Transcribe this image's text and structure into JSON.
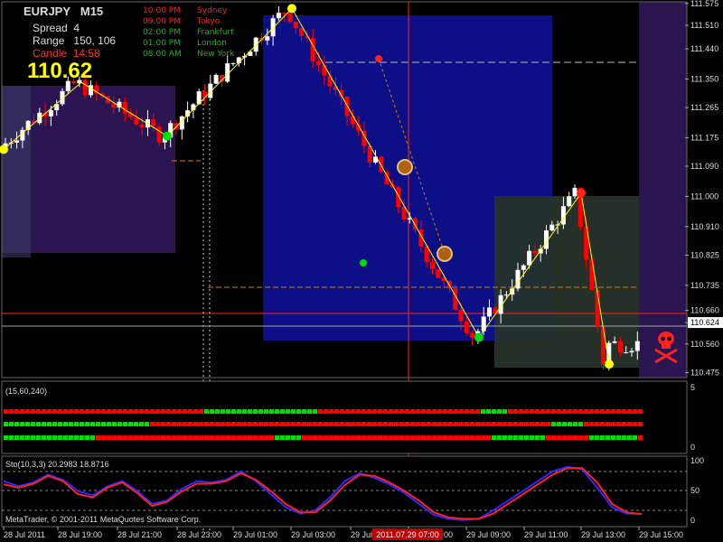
{
  "header": {
    "symbol": "EURJPY",
    "timeframe": "M15",
    "spread_label": "Spread",
    "spread_value": "4",
    "range_label": "Range",
    "range_value": "150, 106",
    "candle_label": "Candle",
    "candle_value": "14:58",
    "price_big": "110.62"
  },
  "sessions": [
    {
      "time": "10:00 PM",
      "name": "Sydney",
      "color": "#ff2020"
    },
    {
      "time": "09:00 PM",
      "name": "Tokyo",
      "color": "#ff2020"
    },
    {
      "time": "02:00 PM",
      "name": "Frankfurt",
      "color": "#20b020"
    },
    {
      "time": "01:00 PM",
      "name": "London",
      "color": "#20b020"
    },
    {
      "time": "08:00 AM",
      "name": "New York",
      "color": "#20b020"
    }
  ],
  "chart_data": [
    {
      "type": "candlestick",
      "title": "EURJPY M15",
      "ylim": [
        110.46,
        111.58
      ],
      "y_ticks": [
        "111.575",
        "111.510",
        "111.440",
        "111.350",
        "111.265",
        "111.175",
        "111.090",
        "111.000",
        "110.910",
        "110.825",
        "110.735",
        "110.660",
        "110.624",
        "110.560",
        "110.475"
      ],
      "x_ticks": [
        "28 Jul 2011",
        "28 Jul 19:00",
        "28 Jul 21:00",
        "28 Jul 23:00",
        "29 Jul 01:00",
        "29 Jul 03:00",
        "29 Jul 05:00",
        "29 Jul 07:00",
        "29 Jul 09:00",
        "29 Jul 11:00",
        "29 Jul 13:00",
        "29 Jul 15:00"
      ],
      "cursor_time": "2011.07.29 07:00",
      "price_lines": {
        "red": "110.662",
        "current": "110.624"
      },
      "zigzag": [
        {
          "time": "28 Jul 2011",
          "price": 111.14
        },
        {
          "time": "28 Jul 19:00",
          "price": 111.34
        },
        {
          "time": "28 Jul 21:00",
          "price": 111.18
        },
        {
          "time": "29 Jul 03:00",
          "price": 111.56
        },
        {
          "time": "29 Jul 09:00",
          "price": 110.58
        },
        {
          "time": "29 Jul 13:00",
          "price": 111.01
        },
        {
          "time": "29 Jul 13:30",
          "price": 110.5
        }
      ],
      "colors": {
        "bull": "#ffffff",
        "bear": "#ff0000",
        "zigzag": "#ffff00",
        "tokyo_box": "#2a1550",
        "london_box": "#0b0f80",
        "ny_box": "#1a2a1a"
      }
    },
    {
      "type": "heatmap",
      "title": "(15,60,240)",
      "rows": 3,
      "ylim": [
        0,
        5
      ],
      "y_ticks": [
        "5",
        "0"
      ],
      "colors": {
        "up": "#00e000",
        "down": "#ff0000"
      }
    },
    {
      "type": "line",
      "title": "Sto(10,3,3) 20.2983 18.8716",
      "series": [
        {
          "name": "main",
          "color": "#2a2aff"
        },
        {
          "name": "signal",
          "color": "#ff2020"
        }
      ],
      "ylim": [
        0,
        100
      ],
      "y_ticks": [
        "100",
        "50",
        "0"
      ],
      "values_main": [
        70,
        62,
        68,
        80,
        72,
        55,
        48,
        62,
        70,
        55,
        35,
        40,
        58,
        70,
        68,
        72,
        85,
        70,
        50,
        30,
        20,
        25,
        45,
        70,
        82,
        75,
        65,
        52,
        35,
        18,
        12,
        10,
        12,
        25,
        40,
        55,
        70,
        85,
        92,
        88,
        60,
        30,
        20,
        20
      ],
      "values_signal": [
        65,
        60,
        66,
        78,
        70,
        50,
        45,
        60,
        68,
        52,
        32,
        38,
        54,
        66,
        66,
        70,
        82,
        72,
        55,
        35,
        22,
        22,
        40,
        64,
        80,
        78,
        68,
        55,
        40,
        22,
        14,
        12,
        12,
        20,
        35,
        50,
        65,
        80,
        90,
        90,
        68,
        35,
        22,
        19
      ]
    }
  ],
  "copyright": "MetaTrader, © 2001-2011 MetaQuotes Software Corp."
}
